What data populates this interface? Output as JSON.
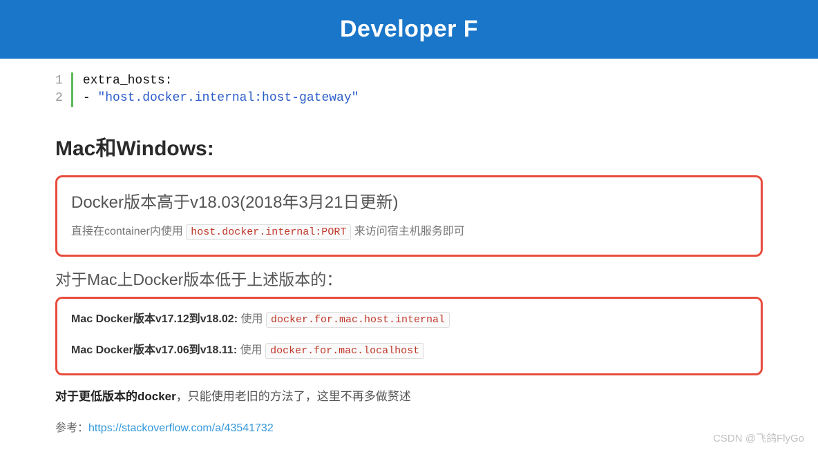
{
  "header": {
    "title": "Developer F"
  },
  "code": {
    "line1_num": "1",
    "line2_num": "2",
    "line1_key": "extra_hosts:",
    "line2_prefix": "- ",
    "line2_string": "\"host.docker.internal:host-gateway\""
  },
  "section": {
    "title": "Mac和Windows:"
  },
  "box1": {
    "title": "Docker版本高于v18.03(2018年3月21日更新)",
    "text_before": "直接在container内使用 ",
    "code": "host.docker.internal:PORT",
    "text_after": " 来访问宿主机服务即可"
  },
  "subheading": "对于Mac上Docker版本低于上述版本的：",
  "box2": {
    "line1_strong": "Mac Docker版本v17.12到v18.02:",
    "line1_text": " 使用 ",
    "line1_code": "docker.for.mac.host.internal",
    "line2_strong": "Mac Docker版本v17.06到v18.11:",
    "line2_text": " 使用 ",
    "line2_code": "docker.for.mac.localhost"
  },
  "plain": {
    "strong": "对于更低版本的docker",
    "rest": "，只能使用老旧的方法了，这里不再多做赘述"
  },
  "reference": {
    "label": "参考：",
    "url": "https://stackoverflow.com/a/43541732"
  },
  "watermark": "CSDN @飞鸽FlyGo"
}
